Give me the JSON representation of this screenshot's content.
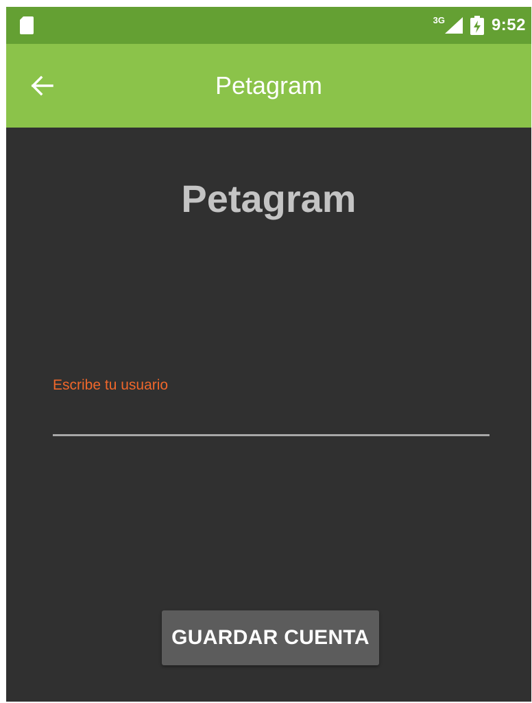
{
  "status_bar": {
    "network_type": "3G",
    "time": "9:52",
    "icons": [
      "sd-card-icon",
      "signal-icon",
      "battery-icon"
    ]
  },
  "app_bar": {
    "title": "Petagram",
    "back_icon": "arrow-left-icon"
  },
  "content": {
    "heading": "Petagram",
    "username_field": {
      "label": "Escribe tu usuario",
      "value": "",
      "placeholder": ""
    },
    "save_button_label": "GUARDAR CUENTA"
  },
  "colors": {
    "status_bar": "#64a033",
    "app_bar": "#8bc34a",
    "background": "#303030",
    "label_accent": "#f0672b",
    "heading": "#c4c4c4",
    "button": "#5c5c5c"
  }
}
